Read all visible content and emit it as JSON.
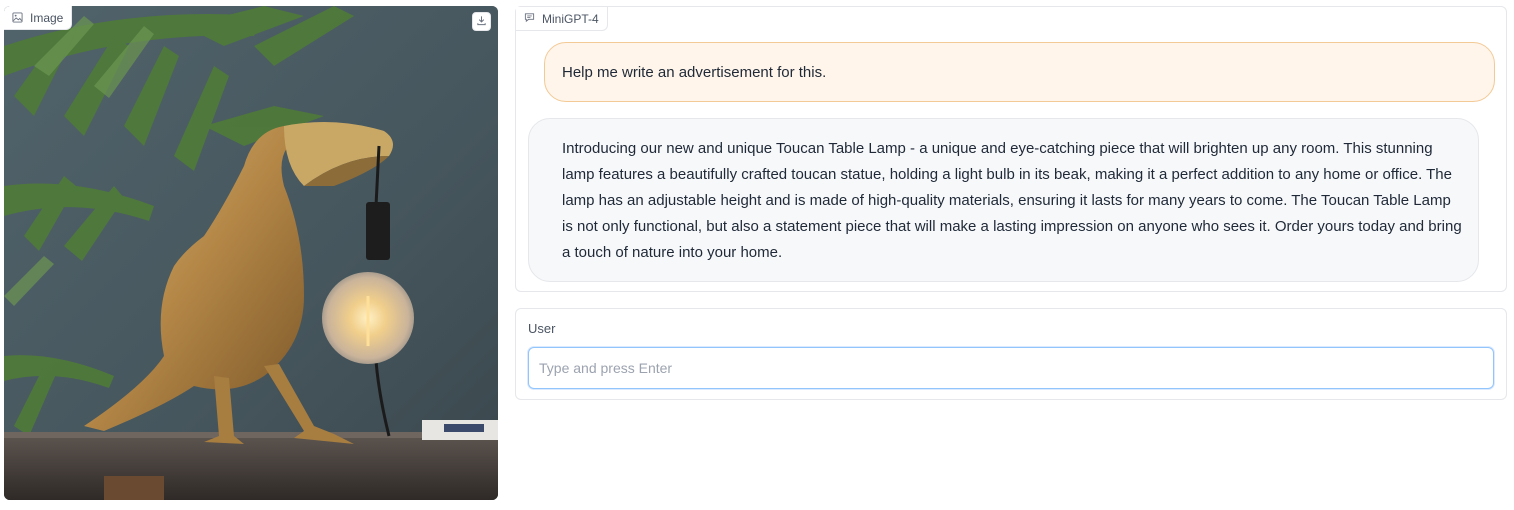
{
  "image_panel": {
    "label": "Image",
    "label_icon": "image-icon",
    "download_icon": "download-icon"
  },
  "chat": {
    "label": "MiniGPT-4",
    "label_icon": "chat-icon",
    "messages": [
      {
        "role": "user",
        "text": "Help me write an advertisement for this."
      },
      {
        "role": "bot",
        "text": "Introducing our new and unique Toucan Table Lamp - a unique and eye-catching piece that will brighten up any room. This stunning lamp features a beautifully crafted toucan statue, holding a light bulb in its beak, making it a perfect addition to any home or office. The lamp has an adjustable height and is made of high-quality materials, ensuring it lasts for many years to come. The Toucan Table Lamp is not only functional, but also a statement piece that will make a lasting impression on anyone who sees it. Order yours today and bring a touch of nature into your home."
      }
    ]
  },
  "input": {
    "label": "User",
    "value": "",
    "placeholder": "Type and press Enter"
  },
  "colors": {
    "user_bubble_bg": "#fff5ea",
    "user_bubble_border": "#f3c996",
    "bot_bubble_bg": "#f7f8fa",
    "input_focus_border": "#93c5fd"
  }
}
